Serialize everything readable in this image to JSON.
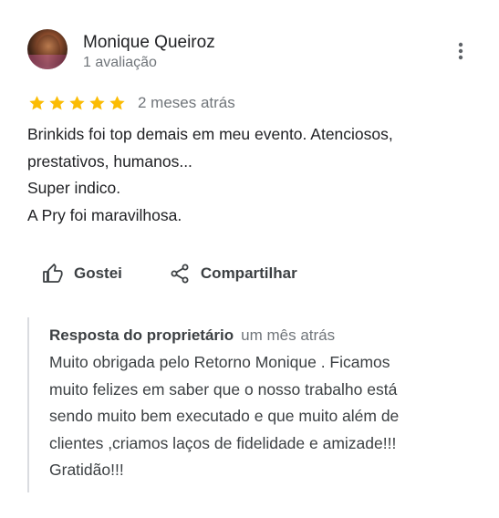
{
  "review": {
    "author": {
      "name": "Monique Queiroz",
      "meta": "1 avaliação"
    },
    "rating": {
      "stars": 5,
      "max": 5,
      "color": "#fbbc04"
    },
    "date": "2 meses atrás",
    "text_lines": [
      "Brinkids foi top demais em meu evento. Atenciosos,",
      "prestativos, humanos...",
      "Super indico.",
      "A Pry foi maravilhosa."
    ],
    "actions": {
      "like_label": "Gostei",
      "share_label": "Compartilhar"
    },
    "owner_reply": {
      "title": "Resposta do proprietário",
      "date": "um mês atrás",
      "text_lines": [
        "Muito obrigada pelo Retorno Monique . Ficamos",
        "muito felizes em saber que o nosso trabalho está",
        "sendo muito bem executado e que muito além de",
        "clientes ,criamos laços de fidelidade e amizade!!!",
        "Gratidão!!!"
      ]
    },
    "icons": {
      "more": "more-vert-icon",
      "star": "star-icon",
      "like": "thumb-up-icon",
      "share": "share-icon"
    }
  }
}
